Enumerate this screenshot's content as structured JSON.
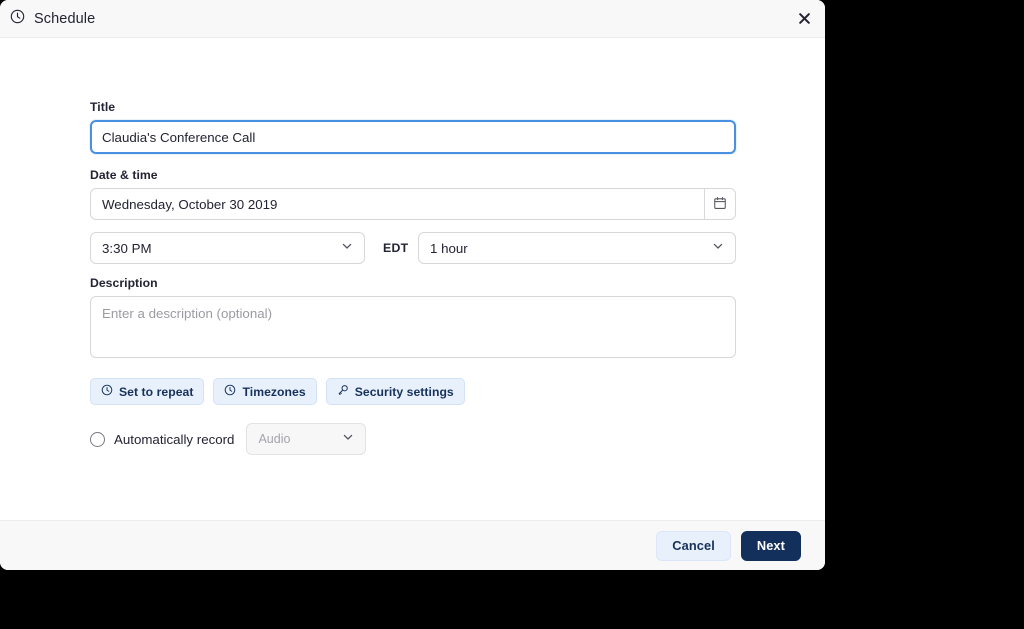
{
  "window": {
    "title": "Schedule",
    "title_icon": "clock-icon",
    "close_icon": "close-icon"
  },
  "form": {
    "title_field": {
      "label": "Title",
      "value": "Claudia's Conference Call",
      "placeholder": "",
      "focused": true
    },
    "datetime": {
      "label": "Date & time",
      "date_value": "Wednesday, October 30 2019",
      "date_placeholder": "",
      "calendar_icon": "calendar-icon",
      "time_value": "3:30 PM",
      "timezone_label": "EDT",
      "duration_value": "1 hour"
    },
    "description": {
      "label": "Description",
      "value": "",
      "placeholder": "Enter a description (optional)"
    },
    "options": [
      {
        "label": "Set to repeat",
        "icon": "clock-icon"
      },
      {
        "label": "Timezones",
        "icon": "clock-icon"
      },
      {
        "label": "Security settings",
        "icon": "key-icon"
      }
    ],
    "record": {
      "label": "Automatically record",
      "checked": false,
      "select_value": "Audio",
      "select_disabled": true
    }
  },
  "footer": {
    "cancel_label": "Cancel",
    "next_label": "Next"
  },
  "colors": {
    "accent_focus": "#4a90e2",
    "primary_button": "#13305c",
    "pill_background": "#e8f0fb",
    "pill_text": "#16325c",
    "header_background": "#f8f8f9",
    "page_background": "#000000"
  }
}
